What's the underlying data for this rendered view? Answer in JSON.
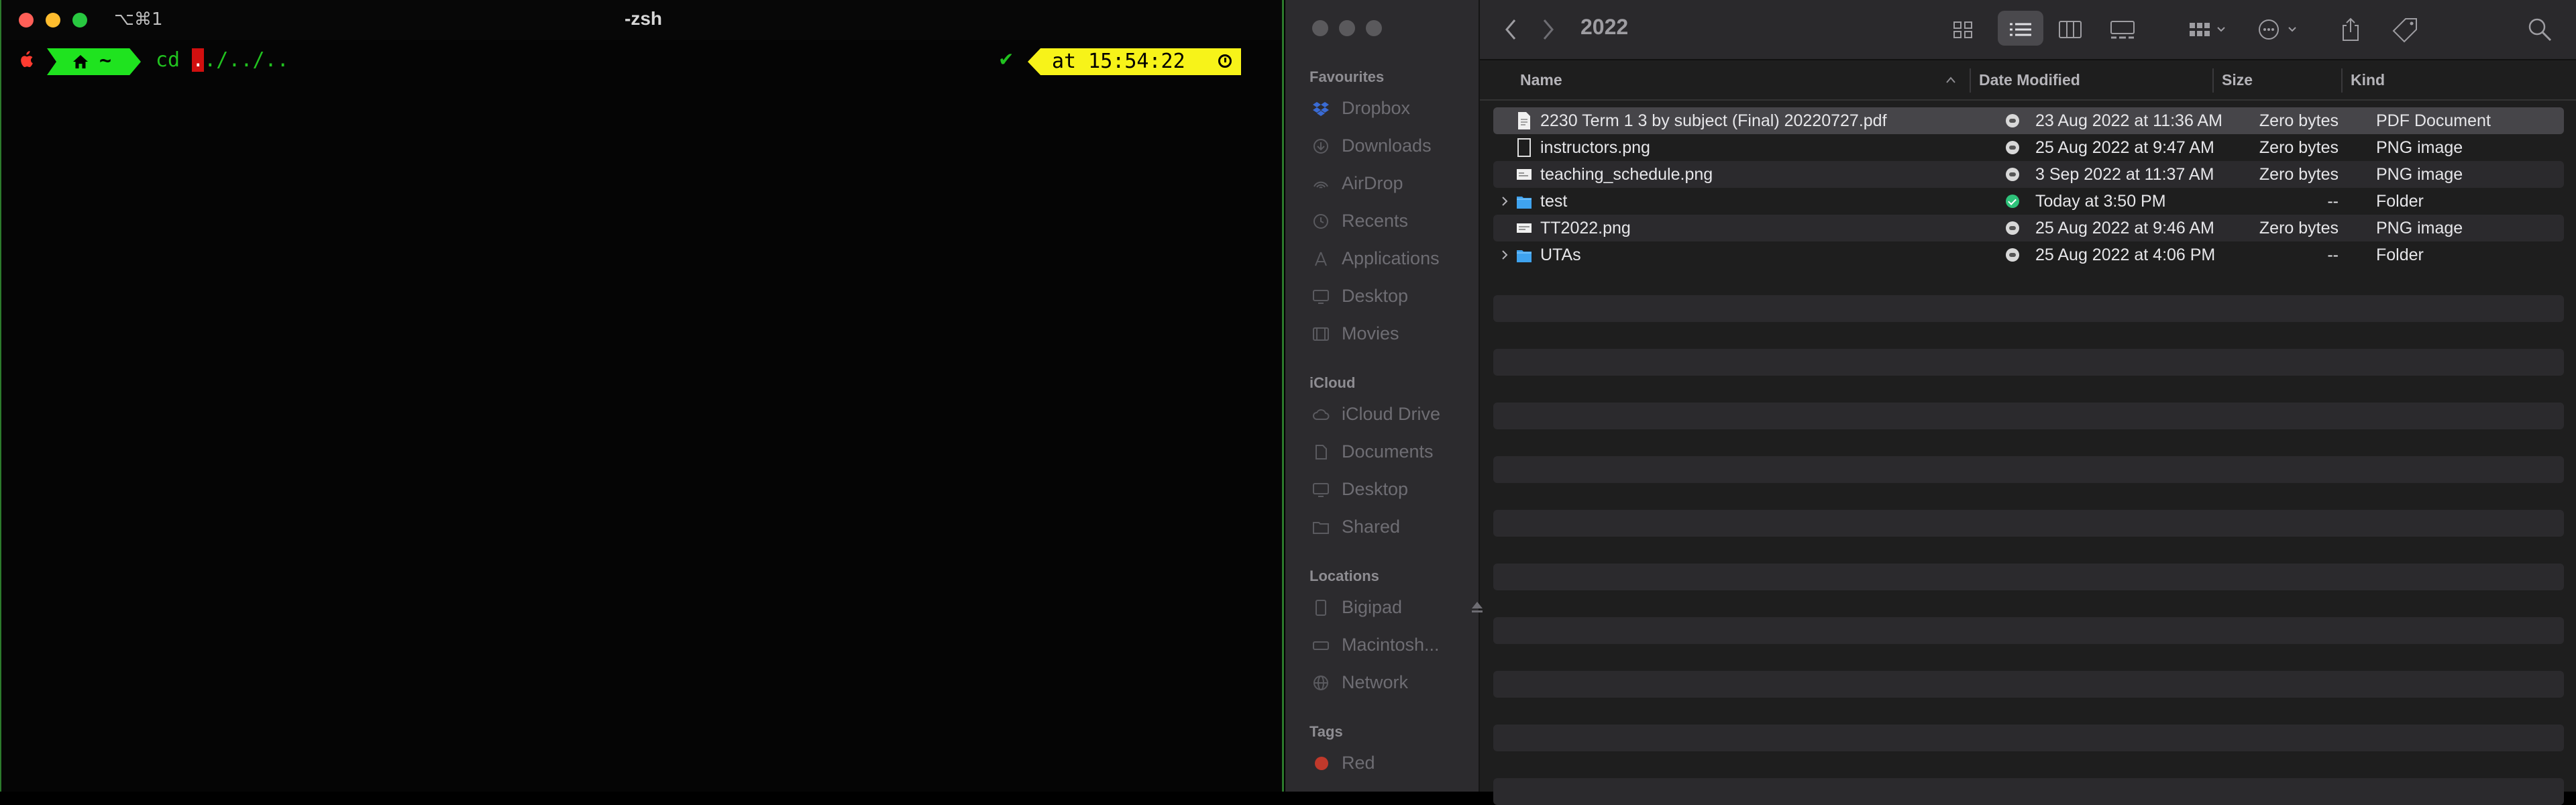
{
  "terminal": {
    "shortcut": "⌥⌘1",
    "title": "-zsh",
    "home_label": "~",
    "command_before": "cd ",
    "command_cursor": ".",
    "command_after": "./../..",
    "check": "✔",
    "time_text": "at 15:54:22"
  },
  "finder": {
    "folder_title": "2022",
    "sidebar": {
      "favourites_header": "Favourites",
      "favourites": [
        {
          "label": "Dropbox",
          "icon": "dropbox-icon"
        },
        {
          "label": "Downloads",
          "icon": "download-icon"
        },
        {
          "label": "AirDrop",
          "icon": "airdrop-icon"
        },
        {
          "label": "Recents",
          "icon": "clock-icon"
        },
        {
          "label": "Applications",
          "icon": "applications-icon"
        },
        {
          "label": "Desktop",
          "icon": "desktop-icon"
        },
        {
          "label": "Movies",
          "icon": "film-icon"
        }
      ],
      "icloud_header": "iCloud",
      "icloud": [
        {
          "label": "iCloud Drive",
          "icon": "cloud-icon"
        },
        {
          "label": "Documents",
          "icon": "document-icon"
        },
        {
          "label": "Desktop",
          "icon": "desktop-icon"
        },
        {
          "label": "Shared",
          "icon": "shared-folder-icon"
        }
      ],
      "locations_header": "Locations",
      "locations": [
        {
          "label": "Bigipad",
          "icon": "ipad-icon"
        },
        {
          "label": "Macintosh...",
          "icon": "disk-icon"
        },
        {
          "label": "Network",
          "icon": "globe-icon"
        }
      ],
      "tags_header": "Tags",
      "tags": [
        {
          "label": "Red",
          "color": "#c0392b"
        }
      ]
    },
    "columns": {
      "name": "Name",
      "date": "Date Modified",
      "size": "Size",
      "kind": "Kind"
    },
    "files": [
      {
        "name": "2230 Term 1 3 by subject (Final) 20220727.pdf",
        "date": "23 Aug 2022 at 11:36 AM",
        "size": "Zero bytes",
        "kind": "PDF Document",
        "type": "pdf",
        "status": "cloud"
      },
      {
        "name": "instructors.png",
        "date": "25 Aug 2022 at 9:47 AM",
        "size": "Zero bytes",
        "kind": "PNG image",
        "type": "png",
        "status": "cloud"
      },
      {
        "name": "teaching_schedule.png",
        "date": "3 Sep 2022 at 11:37 AM",
        "size": "Zero bytes",
        "kind": "PNG image",
        "type": "png",
        "status": "cloud"
      },
      {
        "name": "test",
        "date": "Today at 3:50 PM",
        "size": "--",
        "kind": "Folder",
        "type": "folder",
        "status": "ok"
      },
      {
        "name": "TT2022.png",
        "date": "25 Aug 2022 at 9:46 AM",
        "size": "Zero bytes",
        "kind": "PNG image",
        "type": "png",
        "status": "cloud"
      },
      {
        "name": "UTAs",
        "date": "25 Aug 2022 at 4:06 PM",
        "size": "--",
        "kind": "Folder",
        "type": "folder",
        "status": "cloud"
      }
    ]
  }
}
